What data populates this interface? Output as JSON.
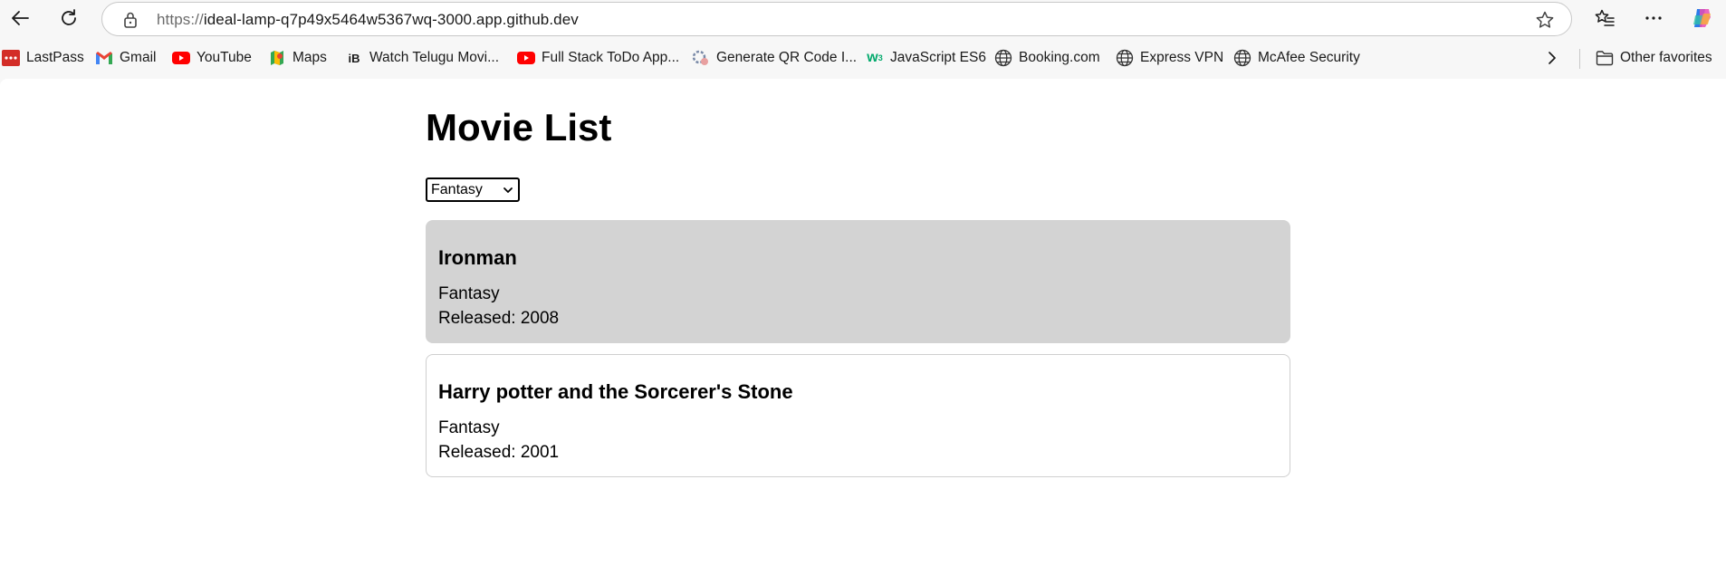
{
  "browser": {
    "url_protocol": "https://",
    "url_host": "ideal-lamp-q7p49x5464w5367wq-3000.app.github.dev"
  },
  "favorites": [
    {
      "label": "LastPass",
      "icon": "lastpass-icon"
    },
    {
      "label": "Gmail",
      "icon": "gmail-icon"
    },
    {
      "label": "YouTube",
      "icon": "youtube-icon"
    },
    {
      "label": "Maps",
      "icon": "maps-icon"
    },
    {
      "label": "Watch Telugu Movi...",
      "icon": "ibomma-icon"
    },
    {
      "label": "Full Stack ToDo App...",
      "icon": "youtube-icon"
    },
    {
      "label": "Generate QR Code I...",
      "icon": "qr-generator-icon"
    },
    {
      "label": "JavaScript ES6",
      "icon": "w3schools-icon"
    },
    {
      "label": "Booking.com",
      "icon": "globe-icon"
    },
    {
      "label": "Express VPN",
      "icon": "globe-icon"
    },
    {
      "label": "McAfee Security",
      "icon": "globe-icon"
    }
  ],
  "other_favorites": "Other favorites",
  "page": {
    "title": "Movie List",
    "genre_filter": "Fantasy",
    "movies": [
      {
        "title": "Ironman",
        "genre": "Fantasy",
        "released": "Released: 2008"
      },
      {
        "title": "Harry potter and the Sorcerer's Stone",
        "genre": "Fantasy",
        "released": "Released: 2001"
      }
    ]
  }
}
